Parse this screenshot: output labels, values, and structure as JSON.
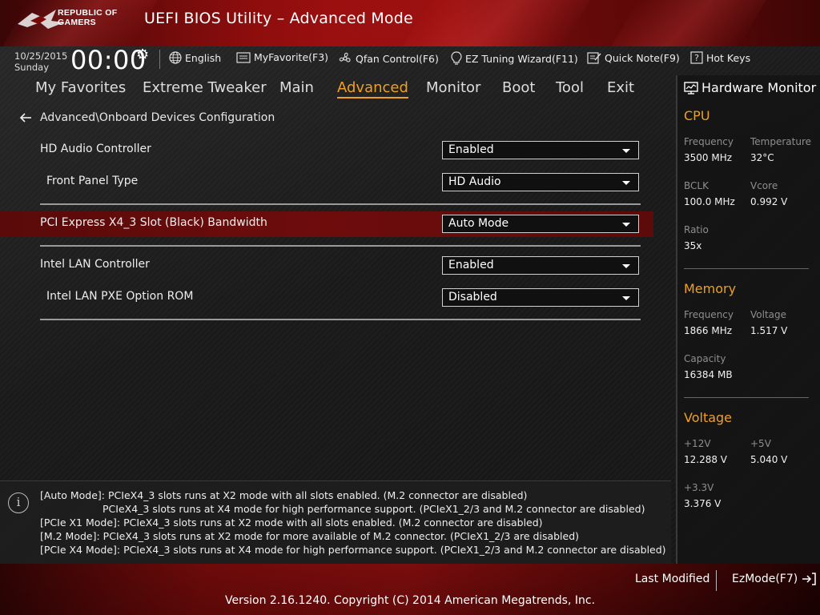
{
  "header": {
    "brand_line1": "REPUBLIC OF",
    "brand_line2": "GAMERS",
    "title": "UEFI BIOS Utility – Advanced Mode"
  },
  "toolbar": {
    "date": "10/25/2015",
    "day": "Sunday",
    "time": "00:00",
    "language": "English",
    "my_favorite": "MyFavorite(F3)",
    "qfan": "Qfan Control(F6)",
    "ez_tuning": "EZ Tuning Wizard(F11)",
    "quick_note": "Quick Note(F9)",
    "hot_keys": "Hot Keys"
  },
  "tabs": {
    "my_favorites": "My Favorites",
    "extreme_tweaker": "Extreme Tweaker",
    "main": "Main",
    "advanced": "Advanced",
    "monitor": "Monitor",
    "boot": "Boot",
    "tool": "Tool",
    "exit": "Exit",
    "active": "Advanced"
  },
  "breadcrumb": "Advanced\\Onboard Devices Configuration",
  "settings": {
    "hd_audio": {
      "label": "HD Audio Controller",
      "value": "Enabled"
    },
    "front_panel": {
      "label": "Front Panel Type",
      "value": "HD Audio"
    },
    "pcie_bandwidth": {
      "label": "PCI Express X4_3 Slot (Black) Bandwidth",
      "value": "Auto Mode"
    },
    "intel_lan": {
      "label": "Intel LAN Controller",
      "value": "Enabled"
    },
    "intel_pxe": {
      "label": "Intel LAN PXE Option ROM",
      "value": "Disabled"
    }
  },
  "hardware_monitor": {
    "title": "Hardware Monitor",
    "cpu": {
      "heading": "CPU",
      "frequency_label": "Frequency",
      "frequency": "3500 MHz",
      "temperature_label": "Temperature",
      "temperature": "32°C",
      "bclk_label": "BCLK",
      "bclk": "100.0 MHz",
      "vcore_label": "Vcore",
      "vcore": "0.992 V",
      "ratio_label": "Ratio",
      "ratio": "35x"
    },
    "memory": {
      "heading": "Memory",
      "frequency_label": "Frequency",
      "frequency": "1866 MHz",
      "voltage_label": "Voltage",
      "voltage": "1.517 V",
      "capacity_label": "Capacity",
      "capacity": "16384 MB"
    },
    "voltage": {
      "heading": "Voltage",
      "v12_label": "+12V",
      "v12": "12.288 V",
      "v5_label": "+5V",
      "v5": "5.040 V",
      "v33_label": "+3.3V",
      "v33": "3.376 V"
    }
  },
  "help": {
    "line1": "[Auto Mode]: PCIeX4_3 slots runs at X2 mode with all slots enabled. (M.2 connector are disabled)",
    "line2": "PCIeX4_3 slots runs at X4 mode for high performance support. (PCIeX1_2/3 and M.2 connector are disabled)",
    "line3": "[PCIe X1 Mode]: PCIeX4_3 slots runs at X2 mode with all slots enabled. (M.2 connector are disabled)",
    "line4": "[M.2 Mode]: PCIeX4_3 slots runs at X2 mode for more available of M.2 connector. (PCIeX1_2/3 are disabled)",
    "line5": "[PCIe X4 Mode]: PCIeX4_3 slots runs at X4 mode for high performance support. (PCIeX1_2/3 and M.2 connector are disabled)"
  },
  "footer": {
    "last_modified": "Last Modified",
    "ez_mode": "EzMode(F7)",
    "copyright": "Version 2.16.1240. Copyright (C) 2014 American Megatrends, Inc."
  },
  "colors": {
    "accent": "#f0a020",
    "header_red": "#b01212",
    "highlight_row": "#6e0c0c"
  }
}
